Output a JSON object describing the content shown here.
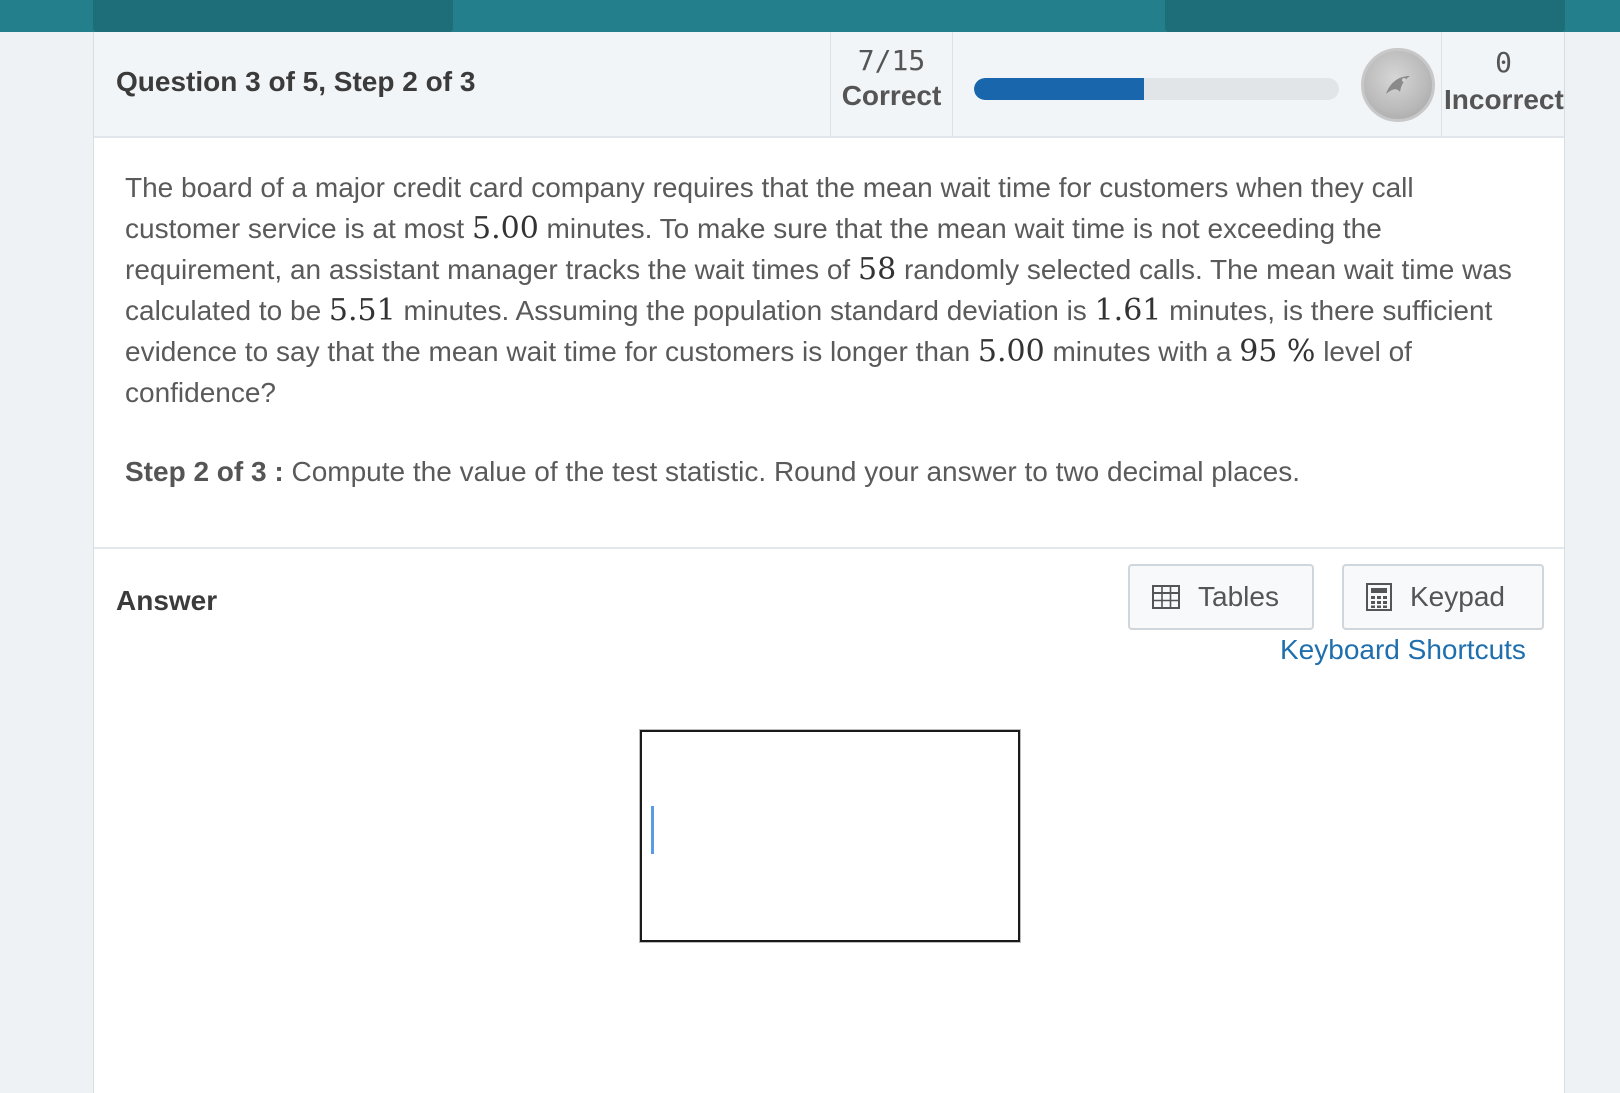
{
  "header": {
    "question_title": "Question 3 of 5,  Step 2 of 3",
    "correct_count": "7/15",
    "correct_label": "Correct",
    "progress_fraction": 0.467,
    "incorrect_count": "0",
    "incorrect_label": "Incorrect"
  },
  "question": {
    "t1": "The board of a major credit card company requires that the mean wait time for customers when they call customer service is at most ",
    "n1": "5.00",
    "t2": " minutes. To make sure that the mean wait time is not exceeding the requirement, an assistant manager tracks the wait times of ",
    "n2": "58",
    "t3": " randomly selected calls. The mean wait time was calculated to be ",
    "n3": "5.51",
    "t4": " minutes. Assuming the population standard deviation is ",
    "n4": "1.61",
    "t5": " minutes, is there sufficient evidence to say that the mean wait time for customers is longer than ",
    "n5": "5.00",
    "t6": " minutes with a ",
    "n6": "95 %",
    "t7": " level of confidence?"
  },
  "step": {
    "label": "Step 2 of 3 :",
    "text": " Compute the value of the test statistic. Round your answer to two decimal places."
  },
  "answer": {
    "label": "Answer",
    "tables_label": "Tables",
    "keypad_label": "Keypad",
    "shortcuts_label": "Keyboard Shortcuts",
    "input_value": ""
  },
  "colors": {
    "topbar": "#237f8c",
    "progress": "#1a66ad",
    "link": "#1f6fae"
  },
  "icons": [
    "table-icon",
    "calculator-icon",
    "achievement-badge-icon"
  ]
}
